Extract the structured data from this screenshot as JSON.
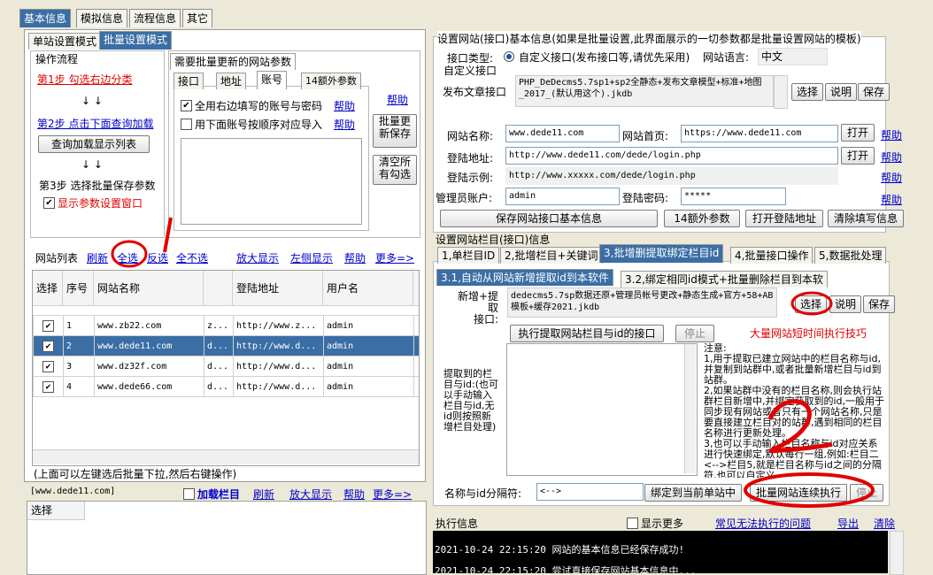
{
  "top_tabs": [
    "基本信息",
    "模拟信息",
    "流程信息",
    "其它"
  ],
  "mode_tabs": [
    "单站设置模式",
    "批量设置模式"
  ],
  "flow": {
    "title": "操作流程",
    "step1": "第1步 勾选右边分类",
    "arrows": "↓ ↓",
    "step2": "第2步 点击下面查询加载",
    "query_btn": "查询加载显示列表",
    "step3": "第3步 选择批量保存参数",
    "show_params": "显示参数设置窗口"
  },
  "batch_params": {
    "title": "需要批量更新的网站参数",
    "tabs": [
      "接口",
      "地址",
      "账号",
      "14额外参数"
    ],
    "opt1": "全用右边填写的账号与密码",
    "opt2": "用下面账号按顺序对应导入",
    "help": "帮助",
    "save_btn": "批量更\n新保存",
    "clear_btn": "清空所\n有勾选"
  },
  "site_list": {
    "title": "网站列表",
    "links": [
      "刷新",
      "全选",
      "反选",
      "全不选",
      "放大显示",
      "左侧显示",
      "帮助",
      "更多=>"
    ],
    "columns": [
      "选择",
      "序号",
      "网站名称",
      "",
      "登陆地址",
      "用户名"
    ],
    "rows": [
      {
        "no": "1",
        "name": "www.zb22.com",
        "short": "z...",
        "url": "http://www.z...",
        "user": "admin"
      },
      {
        "no": "2",
        "name": "www.dede11.com",
        "short": "d...",
        "url": "http://www.d...",
        "user": "admin"
      },
      {
        "no": "3",
        "name": "www.dz32f.com",
        "short": "d...",
        "url": "http://www.d...",
        "user": "admin"
      },
      {
        "no": "4",
        "name": "www.dede66.com",
        "short": "d...",
        "url": "http://www.d...",
        "user": "admin"
      }
    ],
    "hint": "(上面可以左键选后批量下拉,然后右键操作)"
  },
  "bottom_left": {
    "site": "[www.dede11.com]",
    "load_col": "加载栏目",
    "links": [
      "刷新",
      "放大显示",
      "帮助",
      "更多=>"
    ],
    "col_header": "选择"
  },
  "iface": {
    "title": "设置网站(接口)基本信息(如果是批量设置,此界面展示的一切参数都是批量设置网站的模板)",
    "type_label": "接口类型:",
    "type_value": "自定义接口(发布接口等,请优先采用)",
    "lang_label": "网站语言:",
    "lang_value": "中文",
    "custom_label": "自定义接口",
    "publish_label": "发布文章接口",
    "publish_value": "PHP_DeDecms5.7sp1+sp2全静态+发布文章模型+标准+地图_2017_(默认用这个).jkdb",
    "btns": [
      "选择",
      "说明",
      "保存"
    ],
    "name_label": "网站名称:",
    "name_value": "www.dede11.com",
    "home_label": "网站首页:",
    "home_value": "https://www.dede11.com",
    "open": "打开",
    "help": "帮助",
    "login_label": "登陆地址:",
    "login_value": "http://www.dede11.com/dede/login.php",
    "example_label": "登陆示例:",
    "example_value": "http://www.xxxxx.com/dede/login.php",
    "admin_label": "管理员账户:",
    "admin_value": "admin",
    "pwd_label": "登陆密码:",
    "pwd_value": "*****",
    "bottom_btns": [
      "保存网站接口基本信息",
      "14额外参数",
      "打开登陆地址",
      "清除填写信息"
    ]
  },
  "columns": {
    "title": "设置网站栏目(接口)信息",
    "tabs": [
      "1,单栏目ID",
      "2,批增栏目+关键词",
      "3,批增删提取绑定栏目id",
      "4,批量接口操作",
      "5,数据批处理"
    ],
    "sub_tabs": [
      "3.1,自动从网站新增提取id到本软件",
      "3.2,绑定相同id模式+批量删除栏目到本软"
    ],
    "extract_label": "新增+提取\n接口:",
    "extract_value": "dedecms5.7sp数据还原+管理员帐号更改+静态生成+官方+58+AB模板+缓存2021.jkdb",
    "btns": [
      "选择",
      "说明",
      "保存"
    ],
    "exec_btn": "执行提取网站栏目与id的接口",
    "stop_btn": "停止",
    "tip_link": "大量网站短时间执行技巧",
    "left_note": "提取到的栏目与id:(也可以手动输入栏目与id,无id则按照新增栏目处理)",
    "notes": "注意:\n1,用于提取已建立网站中的栏目名称与id,并复制到站群中,或者批量新增栏目与id到站群。\n2,如果站群中没有的栏目名称,则会执行站群栏目新增中,并绑定获取到的id,一般用于同步现有网站或者只有一个网站名称,只是要直接建立栏目对的站群,遇到相同的栏目名称进行更新处理。\n3,也可以手动输入栏目名称与id对应关系进行快速绑定,默认每行一组,例如:栏目二<-->栏目5,就是栏目名称与id之间的分隔符,也可以自定义。",
    "sep_label": "名称与id分隔符:",
    "sep_value": "<-->",
    "bind_btn": "绑定到当前单站中",
    "batch_btn": "批量网站连续执行",
    "stop2": "停止"
  },
  "exec": {
    "title": "执行信息",
    "show_more": "显示更多",
    "faq": "常见无法执行的问题",
    "export": "导出",
    "clear": "清除",
    "logs": [
      "2021-10-24 22:15:20  网站的基本信息已经保存成功!",
      "2021-10-24 22:15:20  尝试直接保存网站基本信息中..."
    ]
  },
  "annotations": {
    "mark_top": "01",
    "mark_bottom": "2",
    "color": "#e00000"
  }
}
